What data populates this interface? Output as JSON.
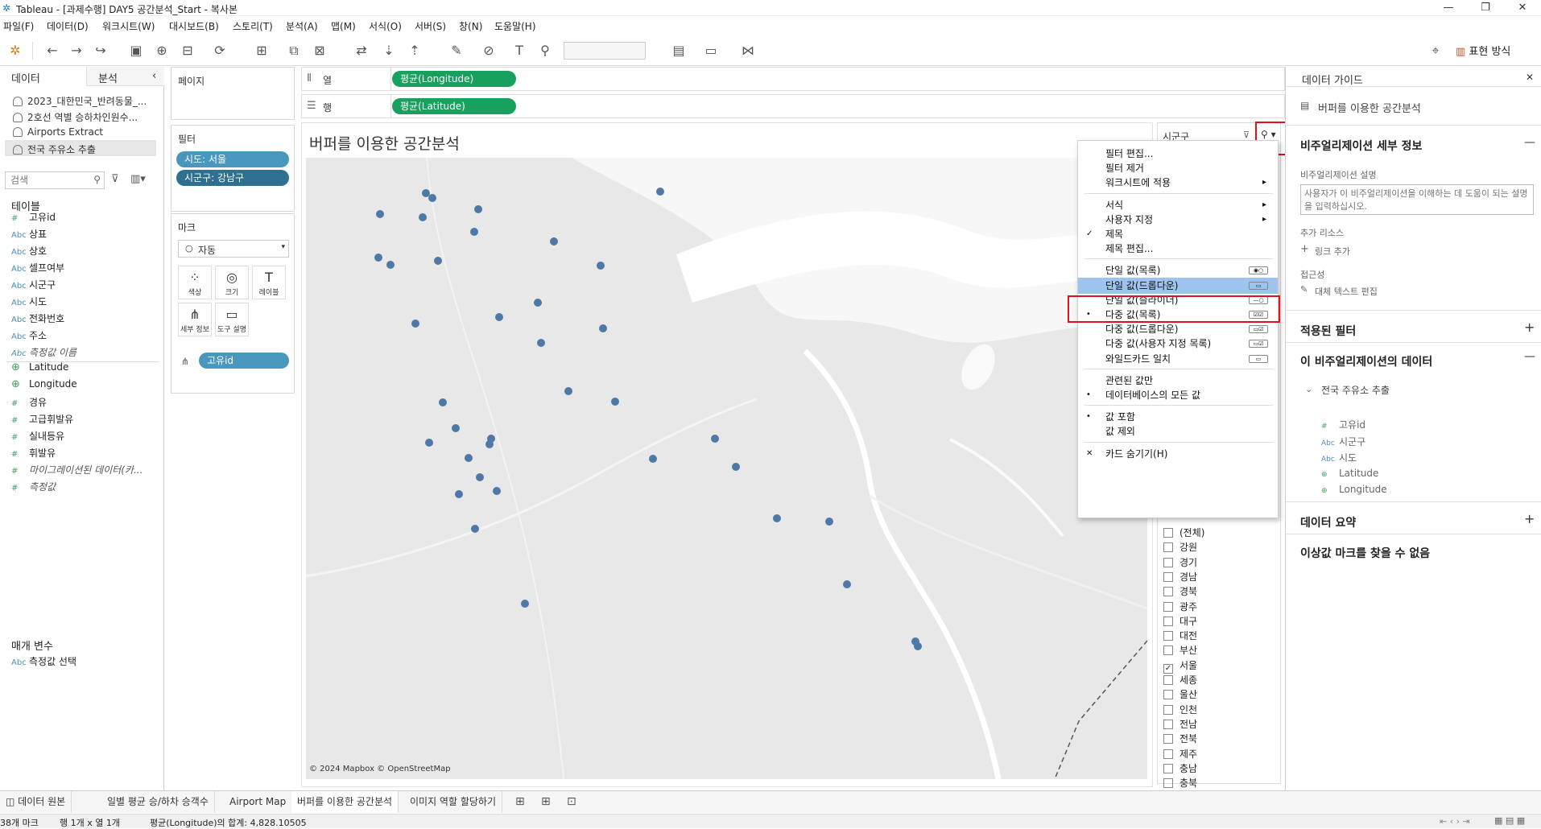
{
  "window": {
    "title": "Tableau - [과제수행] DAY5 공간분석_Start - 복사본",
    "min": "—",
    "max": "❐",
    "close": "✕"
  },
  "menu": [
    "파일(F)",
    "데이터(D)",
    "워크시트(W)",
    "대시보드(B)",
    "스토리(T)",
    "분석(A)",
    "맵(M)",
    "서식(O)",
    "서버(S)",
    "창(N)",
    "도움말(H)"
  ],
  "toolbar": {
    "show_me": "표현 방식"
  },
  "data_pane": {
    "tab_data": "데이터",
    "tab_analysis": "분석",
    "collapse": "‹",
    "datasources": [
      "2023_대한민국_반려동물_...",
      "2호선 역별 승하차인원수...",
      "Airports Extract",
      "전국 주유소 추출"
    ],
    "search_placeholder": "검색",
    "tables_header": "테이블",
    "fields": [
      {
        "type": "#",
        "name": "고유id"
      },
      {
        "type": "Abc",
        "name": "상표"
      },
      {
        "type": "Abc",
        "name": "상호"
      },
      {
        "type": "Abc",
        "name": "셀프여부"
      },
      {
        "type": "Abc",
        "name": "시군구"
      },
      {
        "type": "Abc",
        "name": "시도"
      },
      {
        "type": "Abc",
        "name": "전화번호"
      },
      {
        "type": "Abc",
        "name": "주소"
      },
      {
        "type": "Abc",
        "name": "측정값 이름"
      },
      {
        "type": "⊕",
        "name": "Latitude"
      },
      {
        "type": "⊕",
        "name": "Longitude"
      },
      {
        "type": "#",
        "name": "경유"
      },
      {
        "type": "#",
        "name": "고급휘발유"
      },
      {
        "type": "#",
        "name": "실내등유"
      },
      {
        "type": "#",
        "name": "휘발유"
      },
      {
        "type": "#",
        "name": "마이그레이션된 데이터(카..."
      },
      {
        "type": "#",
        "name": "측정값"
      }
    ],
    "params_header": "매개 변수",
    "params": [
      {
        "type": "Abc",
        "name": "측정값 선택"
      }
    ]
  },
  "shelves": {
    "pages": "페이지",
    "filters_title": "필터",
    "filters": [
      "시도: 서울",
      "시군구: 강남구"
    ],
    "marks_title": "마크",
    "mark_type": "자동",
    "mark_buttons": [
      {
        "icon": "color-icon",
        "glyph": "⁘",
        "label": "색상"
      },
      {
        "icon": "size-icon",
        "glyph": "◎",
        "label": "크기"
      },
      {
        "icon": "label-icon",
        "glyph": "T",
        "label": "레이블"
      },
      {
        "icon": "detail-icon",
        "glyph": "⋔",
        "label": "세부 정보"
      },
      {
        "icon": "tooltip-icon",
        "glyph": "▭",
        "label": "도구 설명"
      }
    ],
    "detail_pill": "고유id",
    "columns_label": "열",
    "rows_label": "행",
    "columns_pill": "평균(Longitude)",
    "rows_pill": "평균(Latitude)"
  },
  "view": {
    "title": "버퍼를 이용한 공간분석",
    "attribution": "© 2024 Mapbox © OpenStreetMap",
    "marks_count": 38
  },
  "filter_card": {
    "title": "시군구",
    "items": [
      {
        "label": "(전체)",
        "checked": false
      },
      {
        "label": "강원",
        "checked": false
      },
      {
        "label": "경기",
        "checked": false
      },
      {
        "label": "경남",
        "checked": false
      },
      {
        "label": "경북",
        "checked": false
      },
      {
        "label": "광주",
        "checked": false
      },
      {
        "label": "대구",
        "checked": false
      },
      {
        "label": "대전",
        "checked": false
      },
      {
        "label": "부산",
        "checked": false
      },
      {
        "label": "서울",
        "checked": true
      },
      {
        "label": "세종",
        "checked": false
      },
      {
        "label": "울산",
        "checked": false
      },
      {
        "label": "인천",
        "checked": false
      },
      {
        "label": "전남",
        "checked": false
      },
      {
        "label": "전북",
        "checked": false
      },
      {
        "label": "제주",
        "checked": false
      },
      {
        "label": "충남",
        "checked": false
      },
      {
        "label": "충북",
        "checked": false
      }
    ]
  },
  "context_menu": {
    "items": [
      {
        "label": "필터 편집...",
        "mark": "",
        "submenu": false
      },
      {
        "label": "필터 제거",
        "mark": "",
        "submenu": false
      },
      {
        "label": "워크시트에 적용",
        "mark": "",
        "submenu": true
      },
      {
        "sep": true
      },
      {
        "label": "서식",
        "mark": "",
        "submenu": true
      },
      {
        "label": "사용자 지정",
        "mark": "",
        "submenu": true
      },
      {
        "label": "제목",
        "mark": "✓",
        "submenu": false
      },
      {
        "label": "제목 편집...",
        "mark": "",
        "submenu": false
      },
      {
        "sep": true
      },
      {
        "label": "단일 값(목록)",
        "mark": "",
        "submenu": false,
        "right": "◉○"
      },
      {
        "label": "단일 값(드롭다운)",
        "mark": "",
        "submenu": false,
        "right": "▭",
        "highlight": true
      },
      {
        "label": "단일 값(슬라이더)",
        "mark": "",
        "submenu": false,
        "right": "—○"
      },
      {
        "label": "다중 값(목록)",
        "mark": "•",
        "submenu": false,
        "right": "☑☑"
      },
      {
        "label": "다중 값(드롭다운)",
        "mark": "",
        "submenu": false,
        "right": "▭☑"
      },
      {
        "label": "다중 값(사용자 지정 목록)",
        "mark": "",
        "submenu": false,
        "right": "▭☑"
      },
      {
        "label": "와일드카드 일치",
        "mark": "",
        "submenu": false,
        "right": "▭"
      },
      {
        "sep": true
      },
      {
        "label": "관련된 값만",
        "mark": "",
        "submenu": false
      },
      {
        "label": "데이터베이스의 모든 값",
        "mark": "•",
        "submenu": false
      },
      {
        "sep": true
      },
      {
        "label": "값 포함",
        "mark": "•",
        "submenu": false
      },
      {
        "label": "값 제외",
        "mark": "",
        "submenu": false
      },
      {
        "sep": true
      },
      {
        "label": "카드 숨기기(H)",
        "mark": "✕",
        "submenu": false
      }
    ]
  },
  "data_guide": {
    "header": "데이터 가이드",
    "sheet_name": "버퍼를 이용한 공간분석",
    "viz_details": "비주얼리제이션 세부 정보",
    "desc_label": "비주얼리제이션 설명",
    "desc_placeholder": "사용자가 이 비주얼리제이션을 이해하는 데 도움이 되는 설명을 입력하십시오.",
    "resources_label": "추가 리소스",
    "add_link": "링크 추가",
    "accessibility": "접근성",
    "alt_text": "대체 텍스트 편집",
    "applied_filters": "적용된 필터",
    "viz_data": "이 비주얼리제이션의 데이터",
    "datasource": "전국 주유소 추출",
    "fields": [
      {
        "type": "#",
        "name": "고유id"
      },
      {
        "type": "Abc",
        "name": "시군구"
      },
      {
        "type": "Abc",
        "name": "시도"
      },
      {
        "type": "⊕",
        "name": "Latitude"
      },
      {
        "type": "⊕",
        "name": "Longitude"
      }
    ],
    "data_summary": "데이터 요약",
    "outliers": "이상값 마크를 찾을 수 없음"
  },
  "sheet_tabs": [
    "데이터 원본",
    "일별 평균 승/하차 승객수",
    "Airport Map",
    "버퍼를 이용한 공간분석",
    "이미지 역할 할당하기"
  ],
  "status": {
    "marks": "38개 마크",
    "dims": "행 1개 x 열 1개",
    "sum": "평균(Longitude)의 합계: 4,828.10505"
  }
}
